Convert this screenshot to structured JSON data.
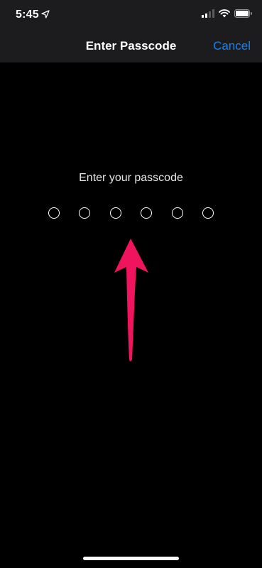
{
  "status_bar": {
    "time": "5:45",
    "location_icon": "location-arrow-icon",
    "signal_icon": "cellular-signal-icon",
    "wifi_icon": "wifi-icon",
    "battery_icon": "battery-icon",
    "signal_bars_active": 2,
    "signal_bars_total": 4,
    "battery_level": 0.9
  },
  "nav": {
    "title": "Enter Passcode",
    "cancel_label": "Cancel"
  },
  "passcode": {
    "prompt": "Enter your passcode",
    "digit_count": 6,
    "filled_count": 0
  },
  "annotation": {
    "icon": "arrow-up-icon",
    "color": "#f0145f"
  },
  "colors": {
    "background": "#000000",
    "nav_background": "#1c1c1e",
    "accent": "#0a84ff",
    "text": "#ffffff"
  }
}
